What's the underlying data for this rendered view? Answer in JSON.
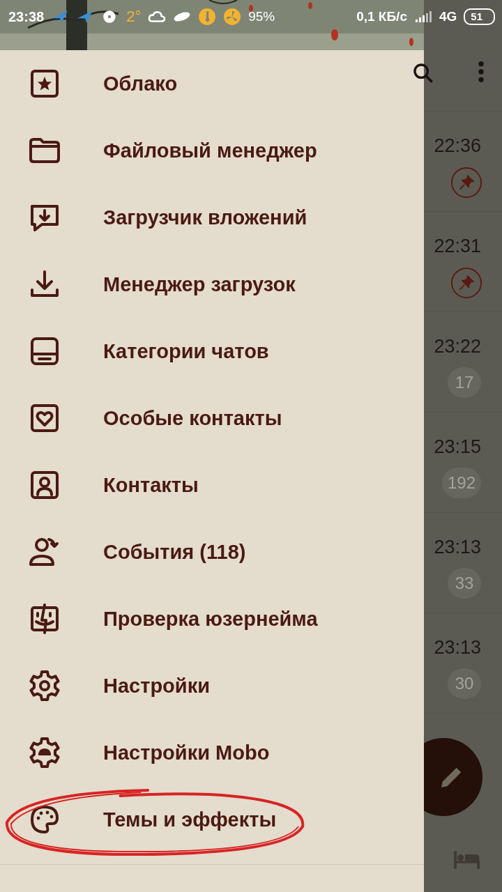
{
  "status_bar": {
    "time": "23:38",
    "temperature": "2°",
    "humidity": "95%",
    "speed": "0,1 КБ/с",
    "network": "4G",
    "battery": "51"
  },
  "drawer": {
    "items": [
      {
        "label": "Облако",
        "highlighted": false
      },
      {
        "label": "Файловый менеджер",
        "highlighted": false
      },
      {
        "label": "Загрузчик вложений",
        "highlighted": false
      },
      {
        "label": "Менеджер загрузок",
        "highlighted": false
      },
      {
        "label": "Категории чатов",
        "highlighted": false
      },
      {
        "label": "Особые контакты",
        "highlighted": false
      },
      {
        "label": "Контакты",
        "highlighted": false
      },
      {
        "label": "События (118)",
        "highlighted": false
      },
      {
        "label": "Проверка юзернейма",
        "highlighted": false
      },
      {
        "label": "Настройки",
        "highlighted": false
      },
      {
        "label": "Настройки Mobo",
        "highlighted": false
      },
      {
        "label": "Темы и эффекты",
        "highlighted": true
      }
    ]
  },
  "chats": [
    {
      "time": "22:36",
      "kind": "pinned"
    },
    {
      "time": "22:31",
      "kind": "pinned"
    },
    {
      "time": "23:22",
      "kind": "unread",
      "badge": "17"
    },
    {
      "time": "23:15",
      "kind": "unread",
      "badge": "192"
    },
    {
      "time": "23:13",
      "kind": "unread",
      "badge": "33"
    },
    {
      "time": "23:13",
      "kind": "unread",
      "badge": "30"
    }
  ]
}
